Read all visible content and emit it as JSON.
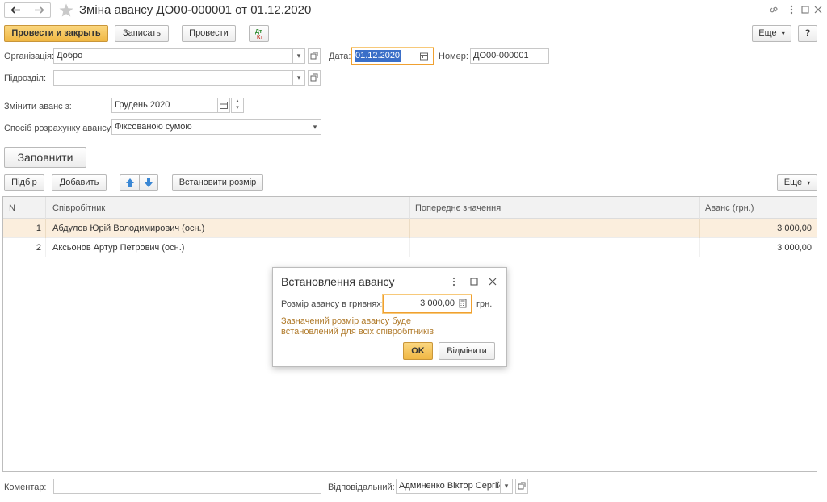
{
  "window": {
    "title": "Зміна авансу ДО00-000001 от 01.12.2020"
  },
  "toolbar": {
    "post_close": "Провести и закрыть",
    "save": "Записать",
    "post": "Провести",
    "more": "Еще",
    "help": "?",
    "dtkt_label": "Дт Кт"
  },
  "form": {
    "org_label": "Організація:",
    "org_value": "Добро",
    "date_label": "Дата:",
    "date_value": "01.12.2020",
    "number_label": "Номер:",
    "number_value": "ДО00-000001",
    "dept_label": "Підрозділ:",
    "dept_value": "",
    "change_from_label": "Змінити аванс з:",
    "change_from_value": "Грудень 2020",
    "calc_method_label": "Спосіб розрахунку авансу:",
    "calc_method_value": "Фіксованою сумою",
    "fill_button": "Заповнити"
  },
  "table_toolbar": {
    "pick": "Підбір",
    "add": "Добавить",
    "set_size": "Встановити розмір",
    "more": "Еще"
  },
  "table": {
    "columns": [
      "N",
      "Співробітник",
      "Попереднє значення",
      "Аванс (грн.)"
    ],
    "rows": [
      {
        "n": "1",
        "employee": "Абдулов Юрій Володимирович (осн.)",
        "previous": "",
        "advance": "3 000,00"
      },
      {
        "n": "2",
        "employee": "Аксьонов Артур Петрович (осн.)",
        "previous": "",
        "advance": "3 000,00"
      }
    ]
  },
  "dialog": {
    "title": "Встановлення авансу",
    "amount_label": "Розмір авансу в гривнях:",
    "amount_value": "3 000,00",
    "currency": "грн.",
    "hint": "Зазначений розмір авансу буде встановлений для всіх співробітників",
    "ok": "OK",
    "cancel": "Відмінити"
  },
  "footer": {
    "comment_label": "Коментар:",
    "comment_value": "",
    "responsible_label": "Відповідальний:",
    "responsible_value": "Админенко Віктор Сергійович"
  },
  "colors": {
    "accent": "#f0b743",
    "selected_row": "#fbeedd",
    "focus_border": "#f0a030",
    "hint_text": "#b07a2a"
  }
}
